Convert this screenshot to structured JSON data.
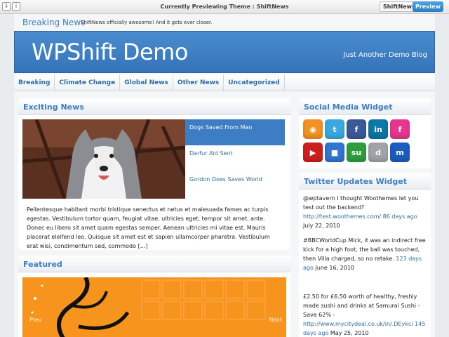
{
  "preview_bar": {
    "title": "Currently Previewing Theme : ShiftNews",
    "theme_button": "ShiftNews",
    "preview_button": "Preview",
    "icons": [
      "download-icon",
      "info-icon"
    ]
  },
  "breaking": {
    "title": "Breaking News",
    "text": "ShiftNews officially awesome! And it gets ever closer."
  },
  "header": {
    "site_title": "WPShift Demo",
    "tagline": "Just Another Demo Blog"
  },
  "nav": {
    "items": [
      {
        "label": "Breaking"
      },
      {
        "label": "Climate Change"
      },
      {
        "label": "Global News"
      },
      {
        "label": "Other News"
      },
      {
        "label": "Uncategorized"
      }
    ]
  },
  "exciting": {
    "title": "Exciting News",
    "slides": [
      {
        "label": "Dogs Saved From Man",
        "active": true
      },
      {
        "label": "Darfur Aid Sent"
      },
      {
        "label": "Gordon Does Saves World"
      }
    ],
    "excerpt": "Pellentesque habitant morbi tristique senectus et netus et malesuada fames ac turpis egestas. Vestibulum tortor quam, feugiat vitae, ultricies eget, tempor sit amet, ante. Donec eu libero sit amet quam egestas semper. Aenean ultricies mi vitae est. Mauris placerat eleifend leo. Quisque sit amet est et sapien ullamcorper pharetra. Vestibulum erat wisi, condimentum sed, commodo [...]"
  },
  "featured": {
    "title": "Featured",
    "prev": "Prev",
    "next": "Next",
    "color": "#f7941d"
  },
  "social": {
    "title": "Social Media Widget",
    "icons": [
      {
        "name": "rss-icon",
        "glyph": "◉",
        "color": "#f39223"
      },
      {
        "name": "twitter-icon",
        "glyph": "t",
        "color": "#39a9e0"
      },
      {
        "name": "facebook-icon",
        "glyph": "f",
        "color": "#3b5998"
      },
      {
        "name": "linkedin-icon",
        "glyph": "in",
        "color": "#0e76a8"
      },
      {
        "name": "flickr-icon",
        "glyph": "f",
        "color": "#e8368f"
      },
      {
        "name": "youtube-icon",
        "glyph": "▶",
        "color": "#cc2020"
      },
      {
        "name": "delicious-icon",
        "glyph": "■",
        "color": "#3274d1"
      },
      {
        "name": "stumbleupon-icon",
        "glyph": "su",
        "color": "#2f9e3e"
      },
      {
        "name": "digg-icon",
        "glyph": "d",
        "color": "#a0a4a8"
      },
      {
        "name": "myspace-icon",
        "glyph": "m",
        "color": "#1c5cc0"
      }
    ]
  },
  "twitter": {
    "title": "Twitter Updates Widget",
    "tweets": [
      {
        "text": "@wptavern I thought Woothemes let you test out the backend?",
        "link": "http://test.woothemes.com/",
        "ago": "86 days ago",
        "date": "July 22, 2010"
      },
      {
        "text": "#BBCWorldCup Mick, it was an indirect free kick for a high foot, the ball was touched, then Villa charged, so no retake.",
        "link": "",
        "ago": "123 days ago",
        "date": "June 16, 2010"
      },
      {
        "text": "£2.50 for £6.50 worth of healthy, freshly made sushi and drinks at Samurai Sushi - Save 62% -",
        "link": "http://www.mycitydeal.co.uk/in/.DEykci",
        "ago": "145 days ago",
        "date": "May 25, 2010"
      }
    ]
  }
}
